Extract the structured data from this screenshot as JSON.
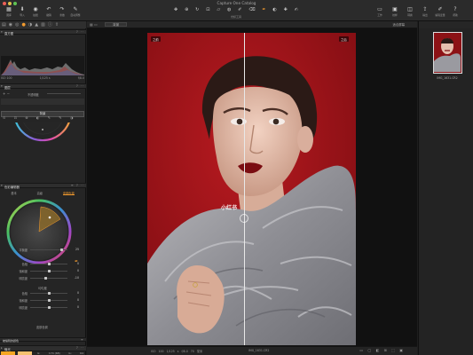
{
  "window": {
    "title": "Capture One Catalog"
  },
  "toolbar": {
    "left": [
      {
        "icon": "grid-icon",
        "glyph": "▦",
        "label": "图库"
      },
      {
        "icon": "import-icon",
        "glyph": "⬇",
        "label": "导入"
      },
      {
        "icon": "camera-icon",
        "glyph": "◉",
        "label": "拍摄"
      },
      {
        "icon": "undo-icon",
        "glyph": "↶",
        "label": "撤销"
      },
      {
        "icon": "redo-icon",
        "glyph": "↷",
        "label": "重做"
      },
      {
        "icon": "auto-adjust-icon",
        "glyph": "✎",
        "label": "自动调整"
      }
    ],
    "cursor_tools_label": "光标工具",
    "right": [
      {
        "icon": "workspace-icon",
        "glyph": "▭",
        "label": "工作"
      },
      {
        "icon": "proof-icon",
        "glyph": "▣",
        "label": "校样"
      },
      {
        "icon": "compare-icon",
        "glyph": "◫",
        "label": "转换"
      },
      {
        "icon": "process-icon",
        "glyph": "⇪",
        "label": "输出"
      },
      {
        "icon": "edit-icon",
        "glyph": "✐",
        "label": "编辑变量"
      },
      {
        "icon": "help-icon",
        "glyph": "?",
        "label": "帮助"
      }
    ]
  },
  "left_panel": {
    "histogram": {
      "title": "直方图",
      "iso": "ISO 100",
      "shutter": "1/125 s",
      "aperture": "f/8.0"
    },
    "layers": {
      "title": "图层",
      "opacity_label": "不透明度",
      "selected_layer": "背景"
    },
    "color_editor": {
      "title": "色彩编辑器",
      "tabs": [
        "基本",
        "高级",
        "皮肤色调"
      ],
      "active_tab": 2
    },
    "sliders": [
      {
        "name": "平衡度",
        "value": "25",
        "fraction": 0.85
      },
      {
        "name": "色相",
        "value": "0",
        "fraction": 0.5
      },
      {
        "name": "饱和度",
        "value": "0",
        "fraction": 0.5
      },
      {
        "name": "明亮度",
        "value": "-10",
        "fraction": 0.42
      }
    ],
    "uniformity_title": "均匀度",
    "uniformity_sliders": [
      {
        "name": "色相",
        "value": "0",
        "fraction": 0.5
      },
      {
        "name": "饱和度",
        "value": "0",
        "fraction": 0.5
      },
      {
        "name": "明亮度",
        "value": "0",
        "fraction": 0.5
      }
    ],
    "skin_label": "皮肤色调",
    "picker_title": "被编辑的颜色",
    "swatch_colors": [
      "#f5a623",
      "#f7c170"
    ],
    "rgb": [
      {
        "ch": "R:",
        "v1": "237 (94)",
        "v2": "R:",
        "v3": "82"
      },
      {
        "ch": "G:",
        "v1": "174 (68)",
        "v2": "G:",
        "v3": "64"
      },
      {
        "ch": "B:",
        "v1": "36 (14)",
        "v2": "B:",
        "v3": "14"
      }
    ],
    "bottom_section": "曝光"
  },
  "viewer": {
    "top_left_label": "背景",
    "top_right_label": "适合屏幕",
    "before_label": "之前",
    "after_label": "之后",
    "watermark": "小红书",
    "meta": "ISO 100   1/125 s   f/8.0   70 毫米",
    "filename": "IMG_1631.CR2"
  },
  "right_panel": {
    "thumbnail_name": "IMG_1631.CR2"
  },
  "colors": {
    "accent": "#f29a2e",
    "backdrop": "#a4141a"
  }
}
